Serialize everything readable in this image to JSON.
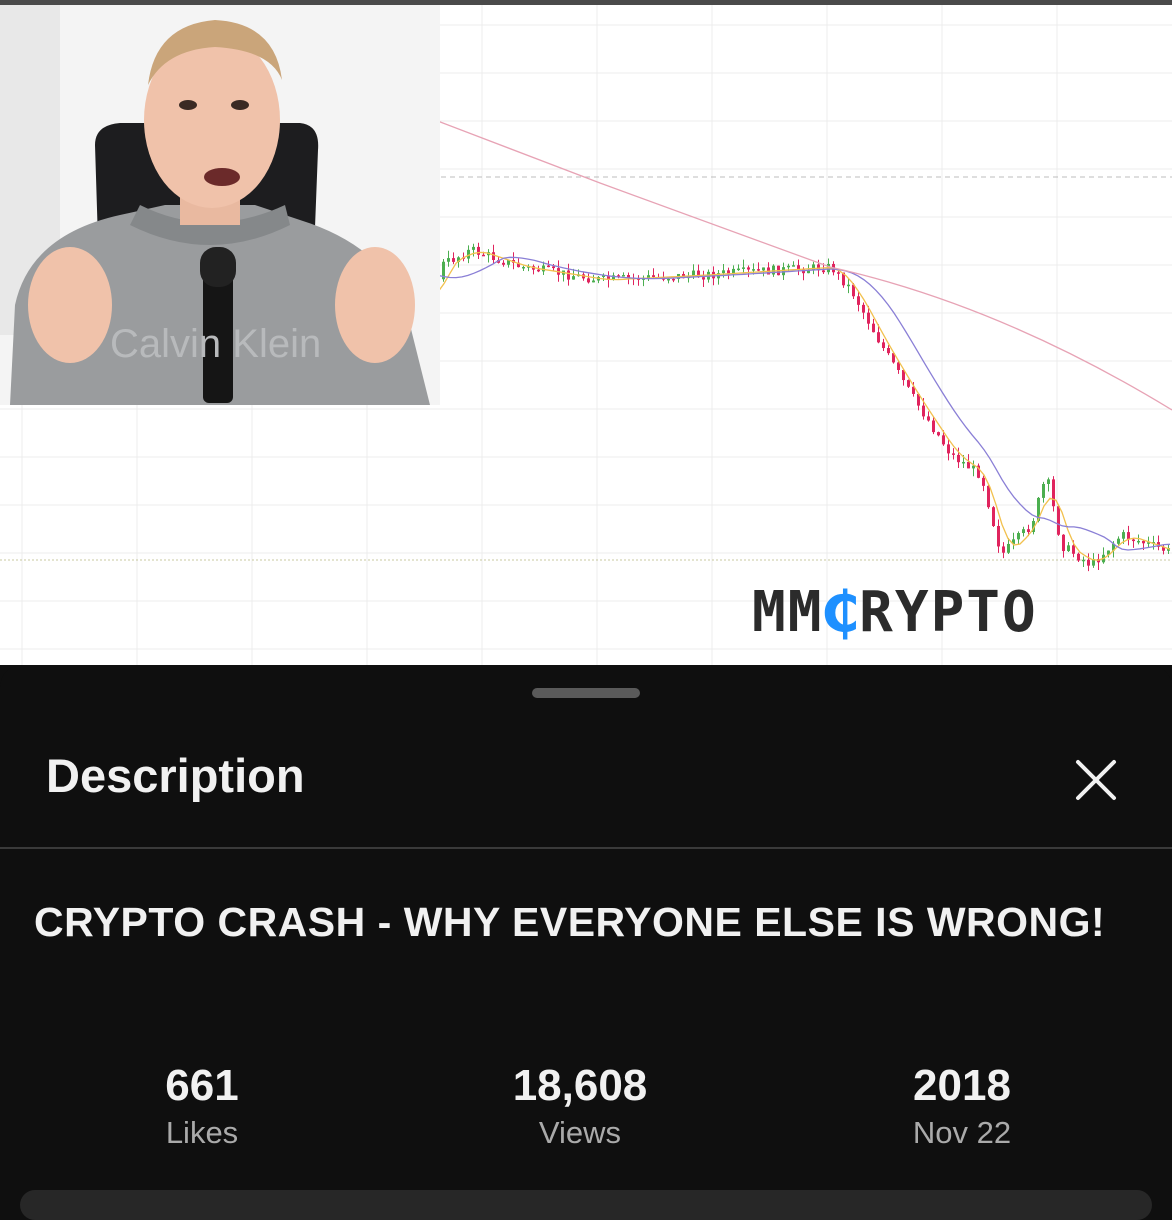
{
  "video": {
    "logo_prefix": "MM",
    "logo_accent": "₵",
    "logo_suffix": "RYPTO",
    "shirt_text": "Calvin Klein",
    "colors": {
      "up_candle": "#4caf50",
      "down_candle": "#e0245e",
      "fast_ma": "#f2c14e",
      "mid_ma": "#8a7fd6",
      "slow_ma": "#e7a3b5",
      "logo_accent": "#1e90ff"
    }
  },
  "sheet": {
    "header_title": "Description",
    "close_icon": "close-icon",
    "video_title": "CRYPTO CRASH - WHY EVERYONE ELSE IS WRONG!",
    "stats": [
      {
        "value": "661",
        "label": "Likes"
      },
      {
        "value": "18,608",
        "label": "Views"
      },
      {
        "value": "2018",
        "label": "Nov 22"
      }
    ]
  }
}
